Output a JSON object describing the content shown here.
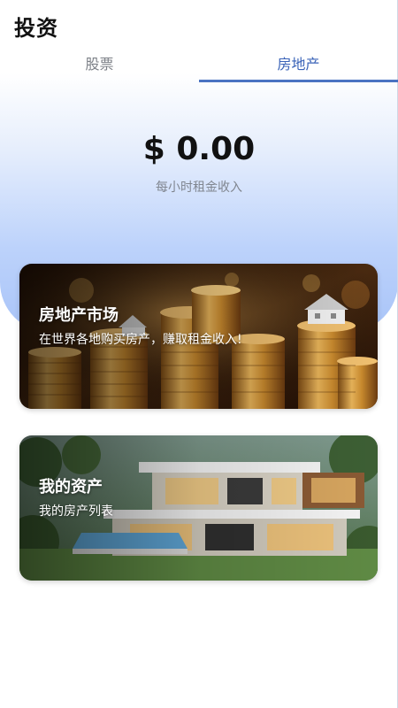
{
  "header": {
    "title": "投资"
  },
  "tabs": [
    {
      "label": "股票",
      "active": false
    },
    {
      "label": "房地产",
      "active": true
    }
  ],
  "balance": {
    "amount": "$ 0.00",
    "caption": "每小时租金收入"
  },
  "cards": [
    {
      "title": "房地产市场",
      "subtitle": "在世界各地购买房产，赚取租金收入!",
      "image": "coin-stacks-with-house-models"
    },
    {
      "title": "我的资产",
      "subtitle": "我的房产列表",
      "image": "modern-villa-with-pool"
    }
  ],
  "colors": {
    "accent": "#4a73c2",
    "active_tab_text": "#3a63b8",
    "inactive_tab_text": "#7b7f86",
    "hero_gradient_end": "#a9c4f8"
  }
}
